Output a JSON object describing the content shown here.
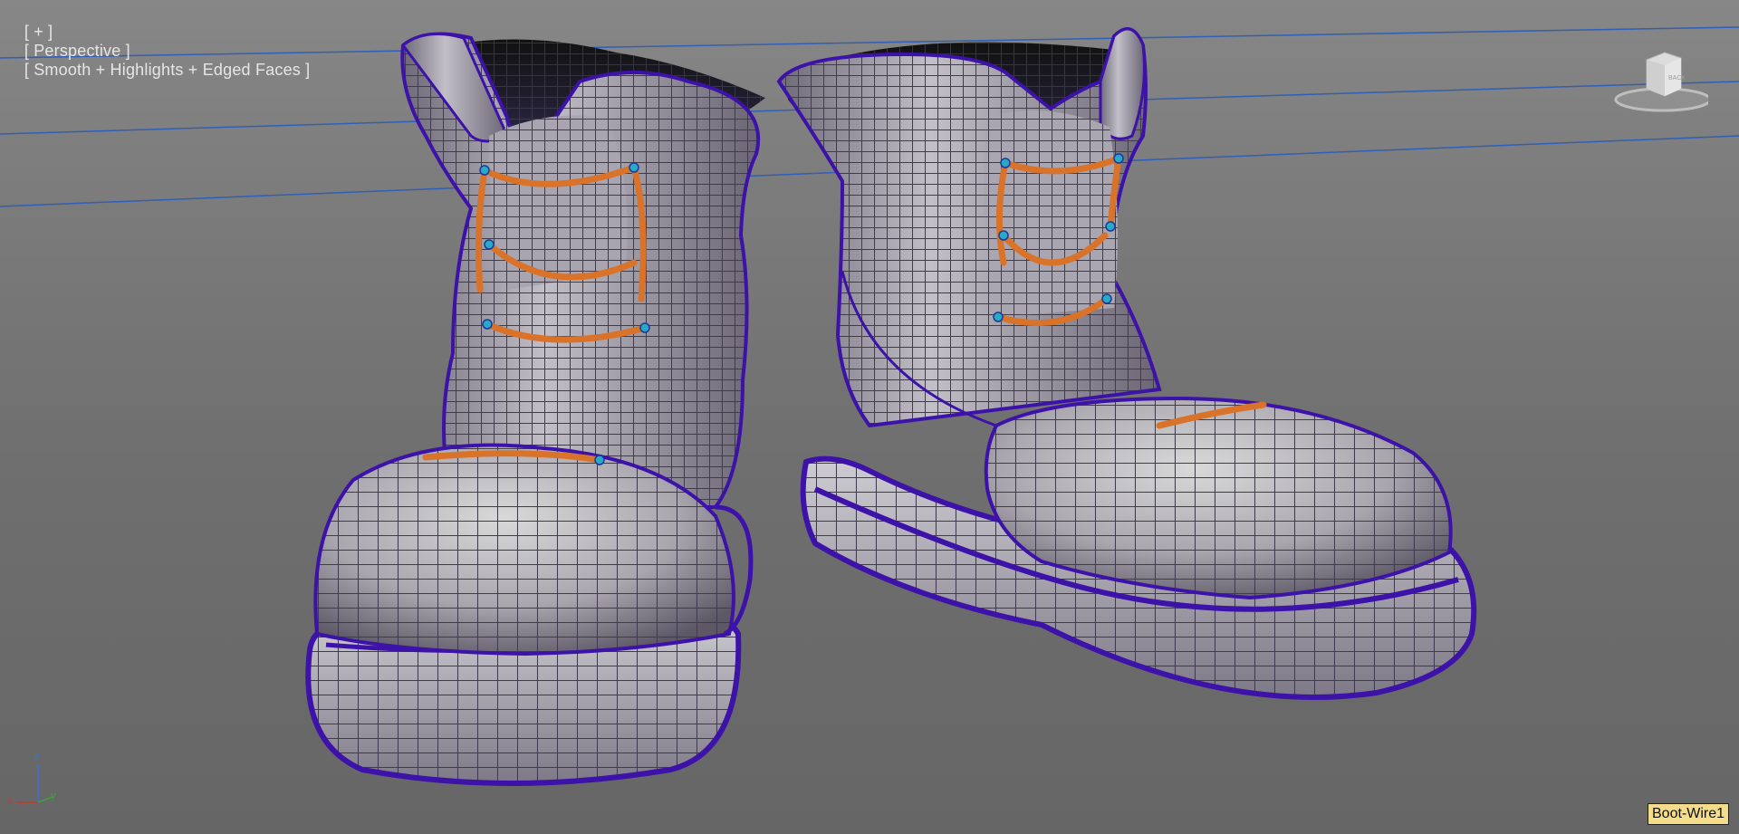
{
  "viewport": {
    "label_plus": "[ + ]",
    "label_view": "[ Perspective ]",
    "label_shading": "[ Smooth + Highlights + Edged Faces ]",
    "object_tooltip": "Boot-Wire1",
    "viewcube_face": "BACK",
    "axes": {
      "x": "x",
      "y": "y",
      "z": "z"
    }
  },
  "colors": {
    "background": "#7a7a7a",
    "wireframe": "#4a1ec8",
    "laces": "#d9732a",
    "grid_line": "#2f5fb8",
    "tooltip": "#f4dc8a"
  },
  "scene": {
    "objects": [
      {
        "name": "boot-left",
        "icon": "boot-mesh"
      },
      {
        "name": "boot-right",
        "icon": "boot-mesh"
      }
    ]
  }
}
